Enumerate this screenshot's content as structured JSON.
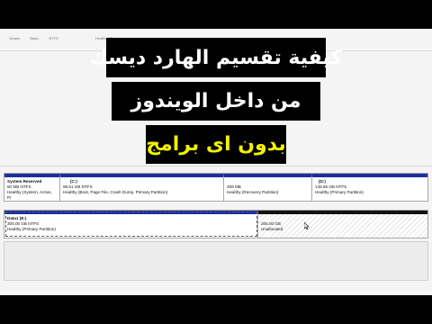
{
  "background": {
    "header": [
      "Simple",
      "Basic",
      "NTFS",
      "Healthy (System"
    ]
  },
  "titles": {
    "line1": "كيفية تقسيم الهارد ديسك",
    "line2": "من داخل الويندوز",
    "line3": "بدون اى برامج"
  },
  "colors": {
    "partition_bar": "#1c2f9c",
    "highlight_text": "#f1f100"
  },
  "disk0": {
    "partitions": [
      {
        "name": "System Reserved",
        "size": "50 MB NTFS",
        "status": "Healthy (System, Active, Pr"
      },
      {
        "name": "(C:)",
        "size": "99.51 GB NTFS",
        "status": "Healthy (Boot, Page File, Crash Dump, Primary Partition)"
      },
      {
        "name": "",
        "size": "499 MB",
        "status": "Healthy (Recovery Partition)"
      },
      {
        "name": "(D:)",
        "size": "148.85 GB NTFS",
        "status": "Healthy (Primary Partition)"
      }
    ]
  },
  "disk1": {
    "partitions": [
      {
        "name": "Data1  (E:)",
        "size": "300.00 GB NTFS",
        "status": "Healthy (Primary Partition)"
      },
      {
        "name": "",
        "size": "205.00 GB",
        "status": "Unallocated"
      }
    ]
  }
}
